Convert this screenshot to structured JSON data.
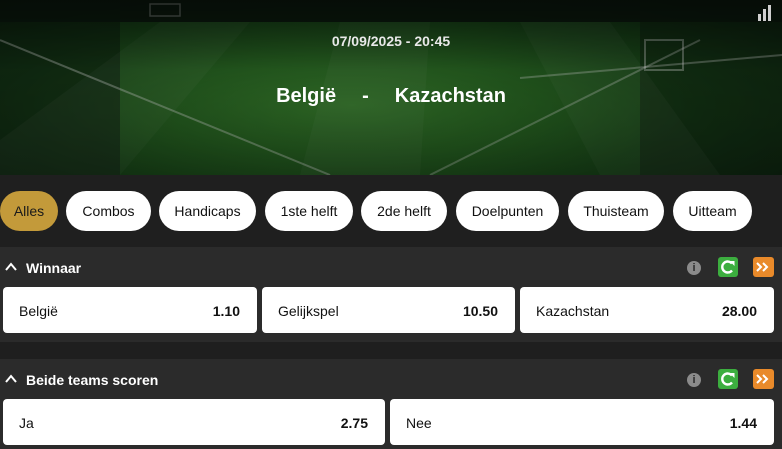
{
  "event": {
    "datetime": "07/09/2025 - 20:45",
    "home_team": "België",
    "separator": "-",
    "away_team": "Kazachstan"
  },
  "icons": {
    "stats": "bar-chart-icon",
    "collapse": "chevron-up-icon",
    "info": "info-icon",
    "cashout": "cashout-icon",
    "fast_forward": "fast-forward-icon"
  },
  "colors": {
    "active_tab": "#c39a3a",
    "cashout_green": "#3cae3f",
    "forward_orange": "#e98a2a",
    "panel_bg": "#2b2b2b",
    "page_bg": "#1f1f1f"
  },
  "tabs": [
    {
      "label": "Alles",
      "active": true
    },
    {
      "label": "Combos",
      "active": false
    },
    {
      "label": "Handicaps",
      "active": false
    },
    {
      "label": "1ste helft",
      "active": false
    },
    {
      "label": "2de helft",
      "active": false
    },
    {
      "label": "Doelpunten",
      "active": false
    },
    {
      "label": "Thuisteam",
      "active": false
    },
    {
      "label": "Uitteam",
      "active": false
    }
  ],
  "markets": [
    {
      "title": "Winnaar",
      "info_glyph": "i",
      "outcomes": [
        {
          "name": "België",
          "odds": "1.10"
        },
        {
          "name": "Gelijkspel",
          "odds": "10.50"
        },
        {
          "name": "Kazachstan",
          "odds": "28.00"
        }
      ]
    },
    {
      "title": "Beide teams scoren",
      "info_glyph": "i",
      "outcomes": [
        {
          "name": "Ja",
          "odds": "2.75"
        },
        {
          "name": "Nee",
          "odds": "1.44"
        }
      ]
    }
  ]
}
